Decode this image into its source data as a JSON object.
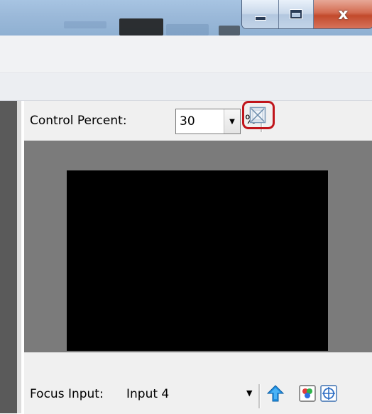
{
  "window": {
    "buttons": {
      "minimize_icon": "minimize-icon",
      "maximize_icon": "maximize-icon",
      "close_icon": "close-icon",
      "close_glyph": "x"
    }
  },
  "control": {
    "label": "Control Percent:",
    "value": "30",
    "unit": "%",
    "fit_icon": "fit-to-window-icon"
  },
  "focus": {
    "label": "Focus Input:",
    "value": "Input 4",
    "icons": [
      "move-up-icon",
      "color-channels-icon",
      "center-target-icon"
    ]
  },
  "colors": {
    "highlight": "#c0151b",
    "stage": "#7b7b7b",
    "video": "#000000"
  }
}
